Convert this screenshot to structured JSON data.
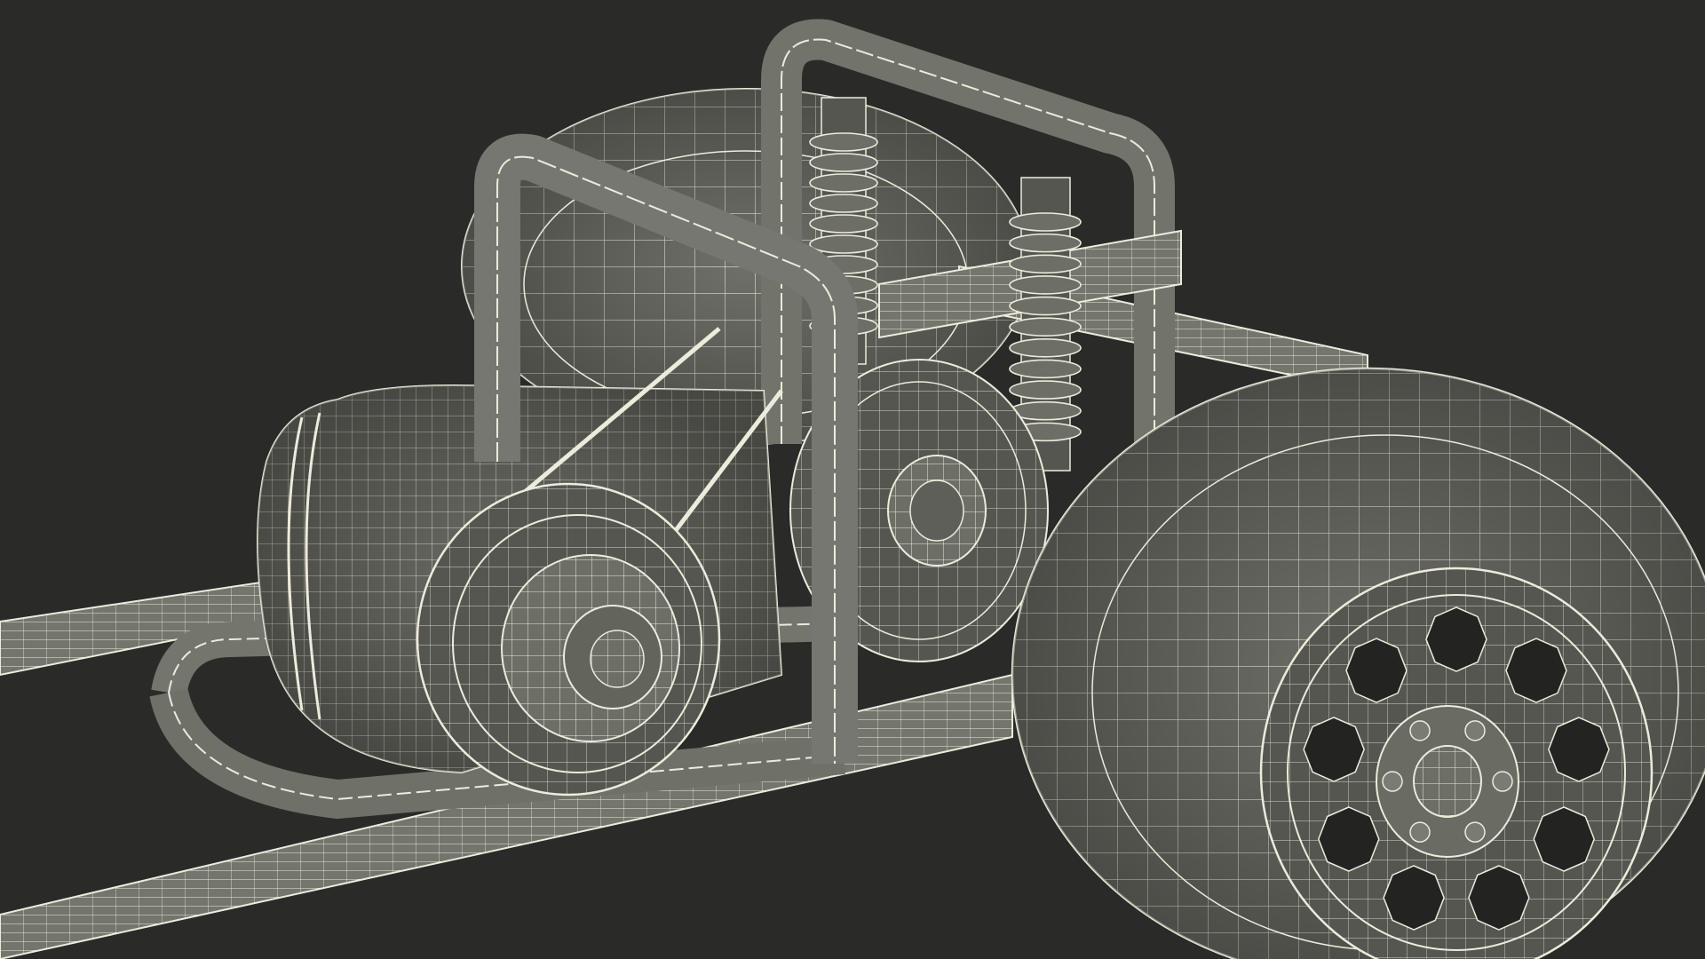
{
  "scene": {
    "kind": "3d-wireframe-render",
    "subject": "go-kart-rear-chassis",
    "colors": {
      "background": "#2a2a29",
      "surface": "#6d6e66",
      "surface_dark": "#4e4f49",
      "surface_light": "#85867d",
      "wire": "#ecebdc",
      "shadow": "#3a3b37"
    },
    "parts": [
      "frame-rails",
      "roll-hoops",
      "coilover-shocks",
      "engine-housing",
      "drive-pulley",
      "driven-pulley",
      "rear-tire",
      "rear-tire-back",
      "wheel-rim"
    ]
  }
}
